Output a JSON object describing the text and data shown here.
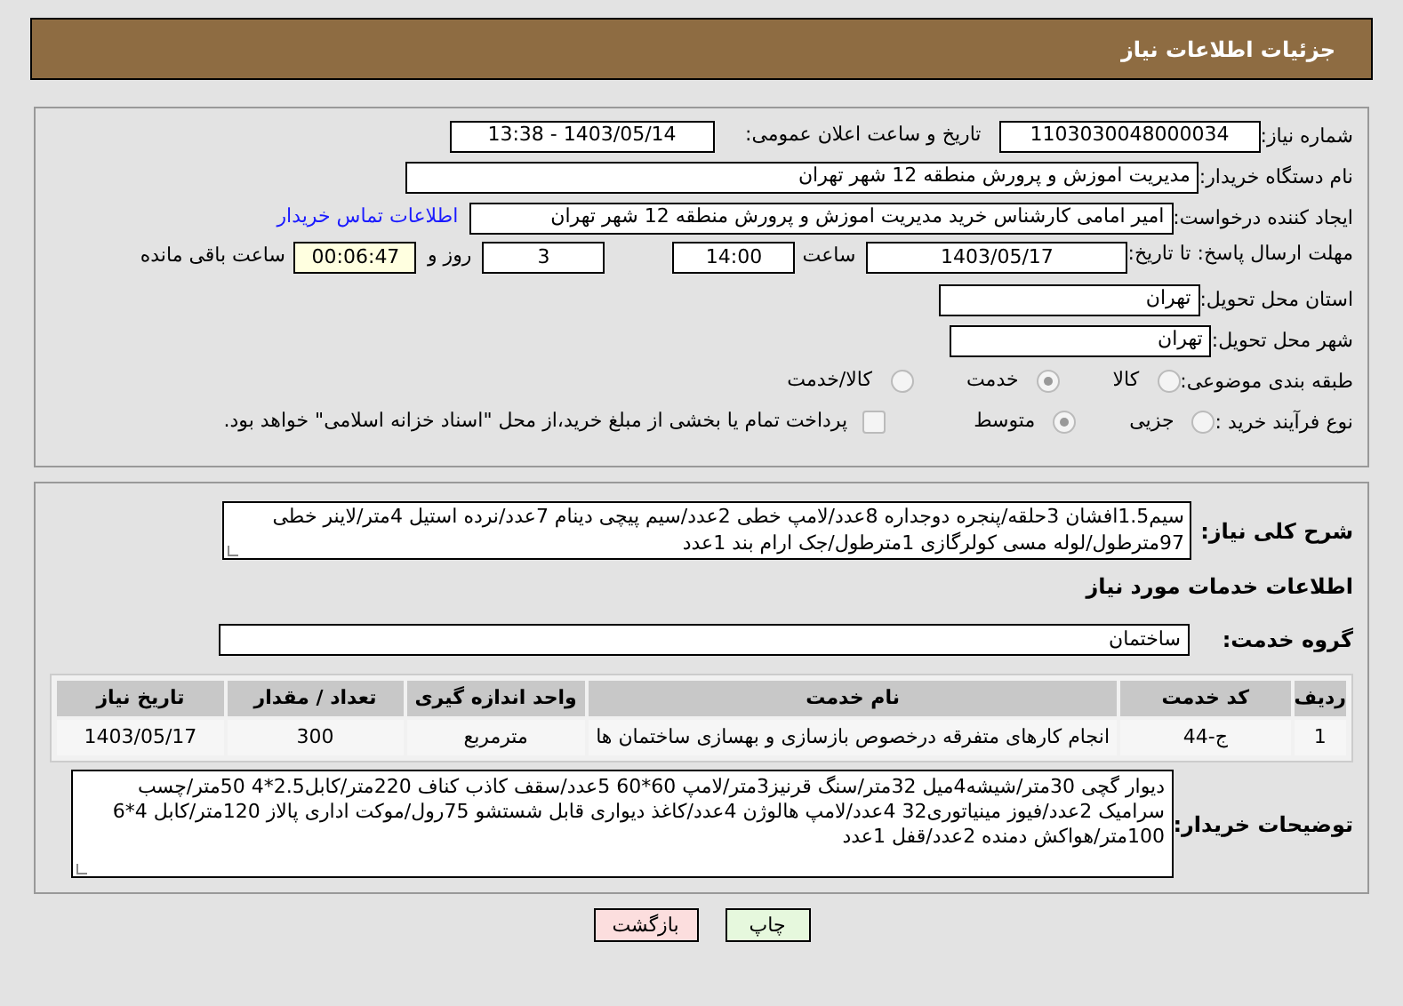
{
  "header": {
    "title": "جزئیات اطلاعات نیاز"
  },
  "need_info": {
    "need_number": {
      "label": "شماره نیاز:",
      "value": "1103030048000034"
    },
    "announce_date": {
      "label": "تاریخ و ساعت اعلان عمومی:",
      "value": "1403/05/14 - 13:38"
    },
    "buyer_org": {
      "label": "نام دستگاه خریدار:",
      "value": "مدیریت اموزش و پرورش منطقه 12 شهر تهران"
    },
    "requester": {
      "label": "ایجاد کننده درخواست:",
      "value": "امیر امامی کارشناس خرید مدیریت اموزش و پرورش منطقه 12 شهر تهران",
      "link": "اطلاعات تماس خریدار"
    },
    "deadline": {
      "label": "مهلت ارسال پاسخ: تا تاریخ:",
      "date": "1403/05/17",
      "time_label": "ساعت",
      "time": "14:00",
      "days": "3",
      "days_label": "روز و",
      "remaining": "00:06:47",
      "remaining_label": "ساعت باقی مانده"
    },
    "province": {
      "label": "استان محل تحویل:",
      "value": "تهران"
    },
    "city": {
      "label": "شهر محل تحویل:",
      "value": "تهران"
    },
    "category": {
      "label": "طبقه بندی موضوعی:",
      "options": [
        {
          "label": "کالا",
          "selected": false
        },
        {
          "label": "خدمت",
          "selected": true
        },
        {
          "label": "کالا/خدمت",
          "selected": false
        }
      ]
    },
    "process": {
      "label": "نوع فرآیند خرید :",
      "options": [
        {
          "label": "جزیی",
          "selected": false
        },
        {
          "label": "متوسط",
          "selected": true
        }
      ],
      "treasury": {
        "label": "پرداخت تمام یا بخشی از مبلغ خرید،از محل \"اسناد خزانه اسلامی\" خواهد بود.",
        "checked": false
      }
    }
  },
  "services": {
    "summary": {
      "label": "شرح کلی نیاز:",
      "value": "سیم1.5افشان 3حلقه/پنجره دوجداره 8عدد/لامپ خطی 2عدد/سیم پیچی دینام 7عدد/نرده استیل 4متر/لاینر خطی 97مترطول/لوله مسی کولرگازی 1مترطول/جک ارام بند 1عدد"
    },
    "heading": "اطلاعات خدمات مورد نیاز",
    "group": {
      "label": "گروه خدمت:",
      "value": "ساختمان"
    },
    "table": {
      "columns": [
        "ردیف",
        "کد خدمت",
        "نام خدمت",
        "واحد اندازه گیری",
        "تعداد / مقدار",
        "تاریخ نیاز"
      ],
      "rows": [
        [
          "1",
          "ج-44",
          "انجام کارهای متفرقه درخصوص بازسازی و بهسازی ساختمان ها",
          "مترمربع",
          "300",
          "1403/05/17"
        ]
      ]
    },
    "buyer_notes": {
      "label": "توضیحات خریدار:",
      "value": "دیوار گچی 30متر/شیشه4میل 32متر/سنگ قرنیز3متر/لامپ 60*60 5عدد/سقف کاذب کناف 220متر/کابل2.5*4 50متر/چسب سرامیک 2عدد/فیوز مینیاتوری32 4عدد/لامپ هالوژن 4عدد/کاغذ دیواری قابل شستشو 75رول/موکت اداری پالاز 120متر/کابل 4*6 100متر/هواکش دمنده 2عدد/قفل 1عدد"
    }
  },
  "buttons": [
    {
      "label": "چاپ",
      "kind": "print"
    },
    {
      "label": "بازگشت",
      "kind": "back"
    }
  ]
}
